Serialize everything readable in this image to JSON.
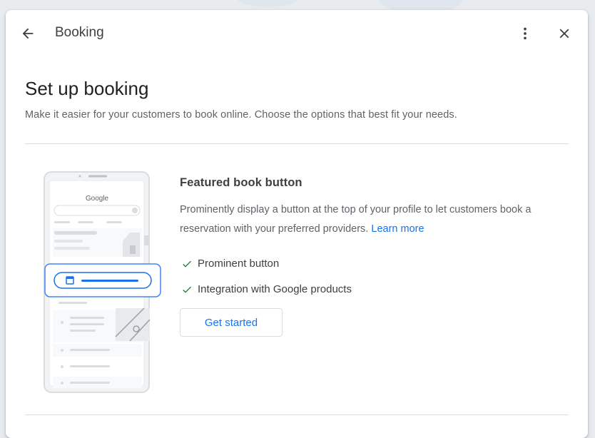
{
  "dialog": {
    "title": "Booking"
  },
  "page": {
    "title": "Set up booking",
    "subtitle": "Make it easier for your customers to book online. Choose the options that best fit your needs."
  },
  "card": {
    "illustration_logo": "Google",
    "title": "Featured book button",
    "description": "Prominently display a button at the top of your profile to let customers book a reservation with your preferred providers.",
    "learn_more": "Learn more",
    "features": [
      "Prominent button",
      "Integration with Google products"
    ],
    "cta": "Get started"
  },
  "icons": {
    "back": "arrow-back-icon",
    "more": "more-vert-icon",
    "close": "close-icon",
    "check": "check-icon",
    "calendar": "calendar-icon"
  },
  "colors": {
    "accent": "#1a73e8",
    "check": "#188038",
    "text": "#202124",
    "muted": "#5f6368"
  }
}
